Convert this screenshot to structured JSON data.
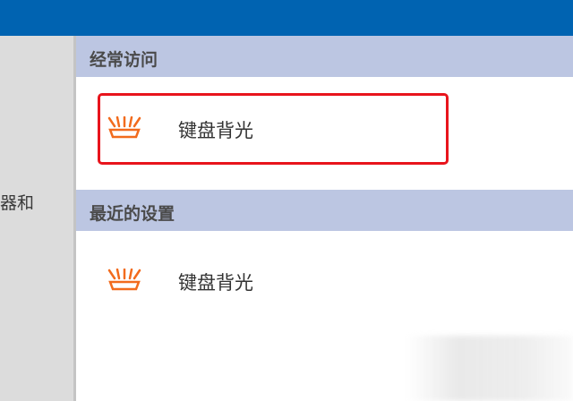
{
  "sidebar": {
    "partial_item_label": "器和"
  },
  "sections": {
    "frequent": {
      "header": "经常访问",
      "items": [
        {
          "label": "键盘背光",
          "icon": "keyboard-backlight-icon",
          "highlighted": true
        }
      ]
    },
    "recent": {
      "header": "最近的设置",
      "items": [
        {
          "label": "键盘背光",
          "icon": "keyboard-backlight-icon"
        }
      ]
    }
  },
  "colors": {
    "titlebar": "#0063b1",
    "section_header_bg": "#bcc6e2",
    "icon_accent": "#f26b1d",
    "highlight_border": "#e8141c",
    "sidebar_bg": "#dcdcdc"
  }
}
